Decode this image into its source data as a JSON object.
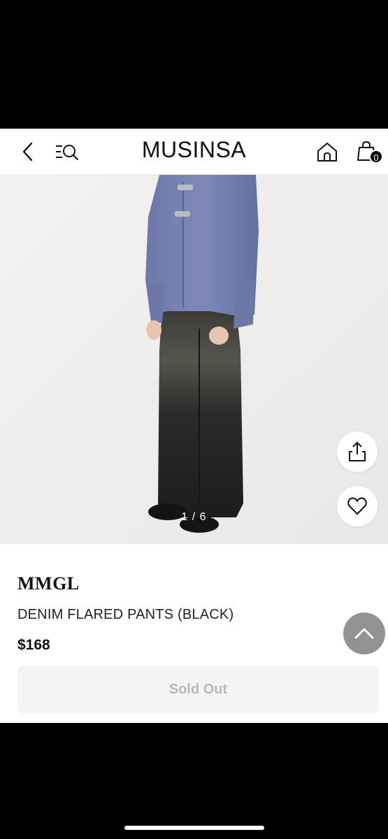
{
  "header": {
    "logo": "MUSINSA",
    "cart_count": "0"
  },
  "gallery": {
    "counter": "1 / 6"
  },
  "product": {
    "brand": "MMGL",
    "name": "DENIM FLARED PANTS (BLACK)",
    "price": "$168",
    "buy_button_label": "Sold Out"
  },
  "icons": {
    "back": "chevron-left-icon",
    "menu_search": "menu-search-icon",
    "home": "home-icon",
    "cart": "shopping-bag-icon",
    "share": "share-icon",
    "wishlist": "heart-icon",
    "scroll_top": "chevron-up-icon"
  },
  "colors": {
    "accent": "#000000",
    "disabled_text": "#b8b8b8",
    "scroll_top_bg": "#8d8d8d"
  }
}
